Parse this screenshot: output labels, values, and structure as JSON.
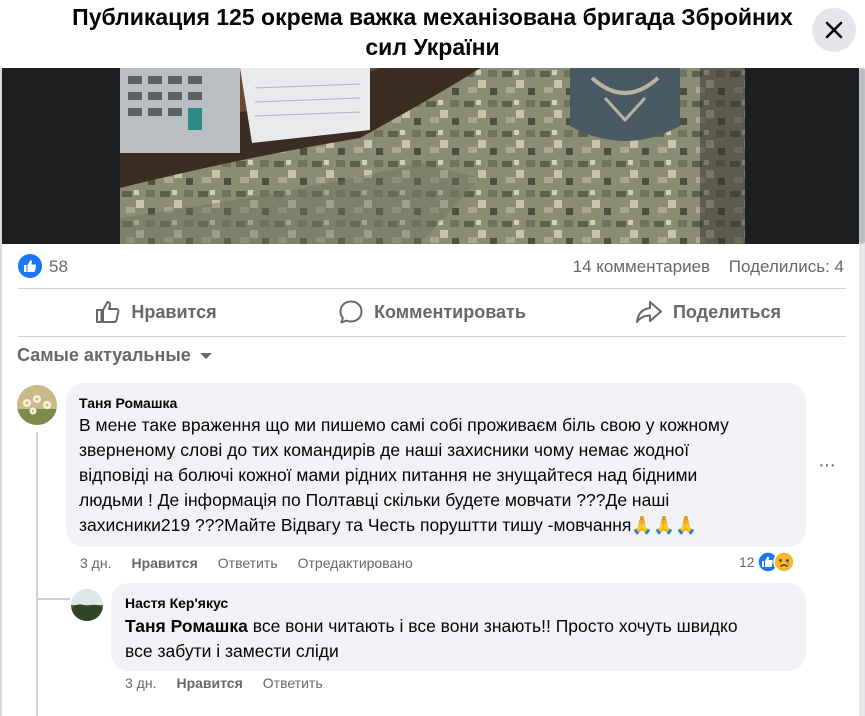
{
  "dialog": {
    "title": "Публикация 125 окрема важка механізована бригада Збройних сил України"
  },
  "post": {
    "like_count": "58",
    "comments_count": "14 комментариев",
    "shares_count": "Поделились: 4",
    "actions": {
      "like": "Нравится",
      "comment": "Комментировать",
      "share": "Поделиться"
    }
  },
  "comments_sort": {
    "label": "Самые актуальные"
  },
  "comments": [
    {
      "author": "Таня Ромашка",
      "lines": [
        "В мене таке враження що ми пишемо самі собі проживаєм біль свою у кожному",
        "зверненому слові до тих командирів де наші захисники чому немає жодної",
        "відповіді на болючі кожної мами рідних питання не знущайтеся над бідними",
        "людьми ! Де інформація по Полтавці скільки будете мовчати ???Де наші",
        "захисники219 ???Майте Відвагу та Честь поруштти тишу -мовчання🙏🙏🙏"
      ],
      "time": "3 дн.",
      "like": "Нравится",
      "reply": "Ответить",
      "edited": "Отредактировано",
      "reaction_count": "12",
      "more": "···"
    },
    {
      "author": "Настя Кер'якус",
      "mention": "Таня Ромашка",
      "line1_rest": " все вони читають і все вони знають!! Просто хочуть швидко",
      "line2": "все забути і замести сліди",
      "time": "3 дн.",
      "like": "Нравится",
      "reply": "Ответить"
    }
  ],
  "colors": {
    "accent": "#1877f2",
    "bubble": "#f0f2f5",
    "secondary_text": "#65676b",
    "divider": "#ced0d4"
  },
  "icons": [
    "close-icon",
    "like-reaction-icon",
    "thumb-up-icon",
    "comment-icon",
    "share-icon",
    "caret-down-icon",
    "sad-reaction-icon"
  ]
}
